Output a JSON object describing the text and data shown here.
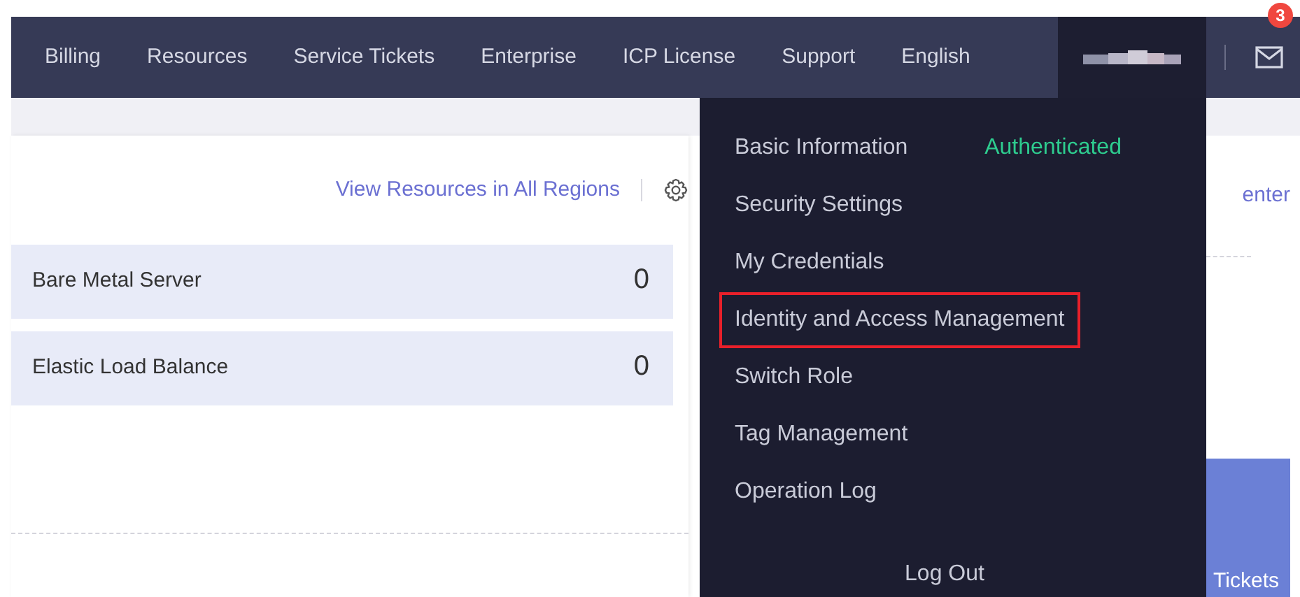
{
  "nav": {
    "items": [
      "Billing",
      "Resources",
      "Service Tickets",
      "Enterprise",
      "ICP License",
      "Support",
      "English"
    ],
    "mail_badge": "3"
  },
  "toolbar": {
    "link": "View Resources in All Regions"
  },
  "resources": [
    {
      "name": "Bare Metal Server",
      "count": "0"
    },
    {
      "name": "Elastic Load Balance",
      "count": "0"
    }
  ],
  "side_card": {
    "link": "enter",
    "tile_label": "Tickets"
  },
  "account_menu": {
    "items": [
      {
        "label": "Basic Information",
        "status": "Authenticated",
        "highlighted": false
      },
      {
        "label": "Security Settings",
        "highlighted": false
      },
      {
        "label": "My Credentials",
        "highlighted": false
      },
      {
        "label": "Identity and Access Management",
        "highlighted": true
      },
      {
        "label": "Switch Role",
        "highlighted": false
      },
      {
        "label": "Tag Management",
        "highlighted": false
      },
      {
        "label": "Operation Log",
        "highlighted": false
      }
    ],
    "logout": "Log Out"
  }
}
